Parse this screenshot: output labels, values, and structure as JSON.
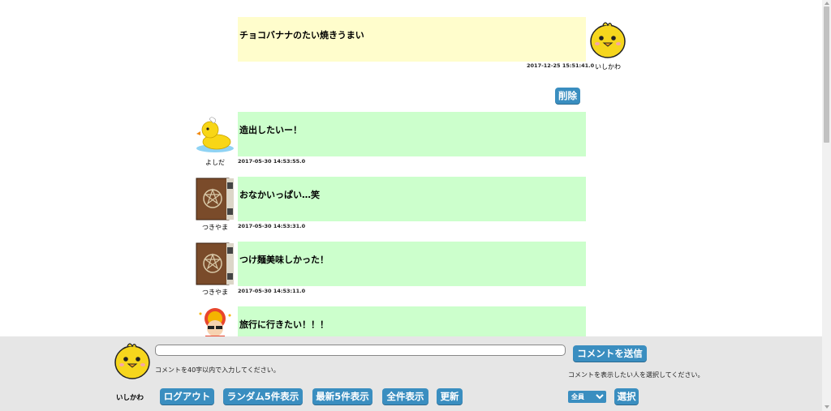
{
  "messages": [
    {
      "text": "チョコバナナのたい焼きうまい",
      "timestamp": "2017-12-25 15:51:41.0",
      "user": "いしかわ",
      "avatar": "chick-icon",
      "color": "#fffdcc",
      "own": true
    },
    {
      "text": "造出したいー！",
      "timestamp": "2017-05-30 14:53:55.0",
      "user": "よしだ",
      "avatar": "rubber-duck-icon",
      "color": "#ccffcc",
      "own": false
    },
    {
      "text": "おなかいっぱい…笑",
      "timestamp": "2017-05-30 14:53:31.0",
      "user": "つきやま",
      "avatar": "spellbook-icon",
      "color": "#ccffcc",
      "own": false
    },
    {
      "text": "つけ麺美味しかった！",
      "timestamp": "2017-05-30 14:53:11.0",
      "user": "つきやま",
      "avatar": "spellbook-icon",
      "color": "#ccffcc",
      "own": false
    },
    {
      "text": "旅行に行きたい！！！",
      "timestamp": "",
      "user": "",
      "avatar": "festival-person-icon",
      "color": "#ccffcc",
      "own": false
    }
  ],
  "delete_label": "削除",
  "footer": {
    "current_user": "いしかわ",
    "comment_value": "",
    "comment_hint": "コメントを40字以内で入力してください。",
    "send_label": "コメントを送信",
    "filter_hint": "コメントを表示したい人を選択してください。",
    "select_value": "全員",
    "select_label": "選択",
    "buttons": {
      "logout": "ログアウト",
      "random5": "ランダム5件表示",
      "latest5": "最新5件表示",
      "all": "全件表示",
      "refresh": "更新"
    }
  }
}
